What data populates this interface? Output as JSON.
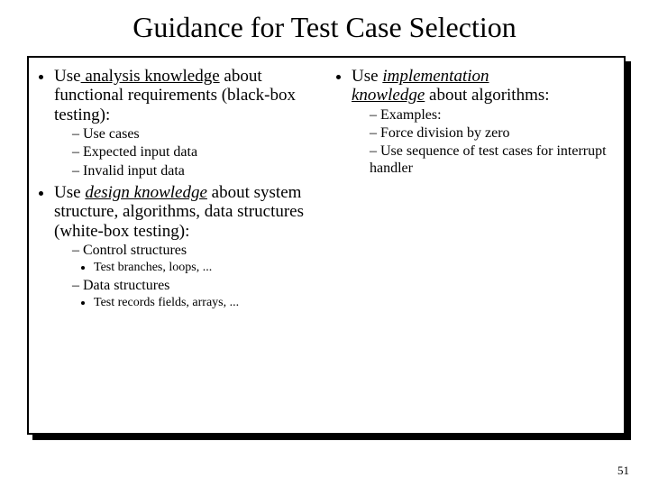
{
  "slide": {
    "title": "Guidance for Test Case Selection",
    "page_number": "51"
  },
  "left": {
    "b1_pre": "Use",
    "b1_mid": " analysis  knowledge",
    "b1_post": " about functional requirements (black-box testing):",
    "b1_s1": "Use cases",
    "b1_s2": "Expected input data",
    "b1_s3": "Invalid input data",
    "b2_pre": "Use ",
    "b2_mid": "design  knowledge",
    "b2_post": " about system structure, algorithms, data structures  (white-box testing):",
    "b2_s1": "Control structures",
    "b2_s1_d1": "Test branches, loops, ...",
    "b2_s2": "Data structures",
    "b2_s2_d1": "Test records fields, arrays, ..."
  },
  "right": {
    "b1_pre": "Use ",
    "b1_mid": "implementation",
    "b1_line2": "knowledge",
    "b1_post": " about algorithms:",
    "b1_s1": "Examples:",
    "b1_s2": "Force division by zero",
    "b1_s3": "Use sequence of test cases for interrupt handler"
  }
}
